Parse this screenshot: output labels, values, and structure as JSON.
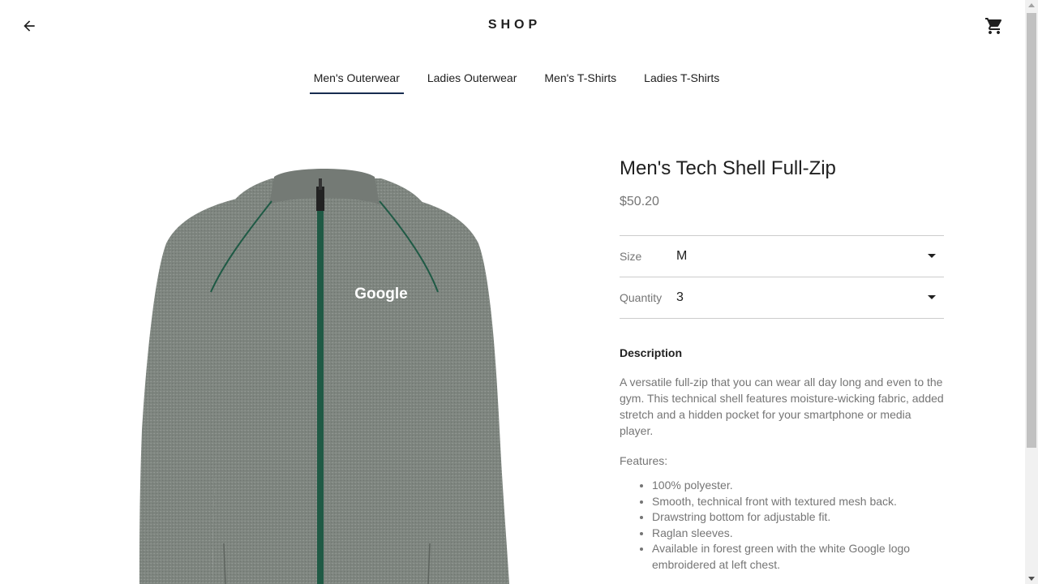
{
  "header": {
    "logo": "SHOP",
    "back_icon": "arrow-back-icon",
    "cart_icon": "shopping-cart-icon"
  },
  "tabs": [
    {
      "label": "Men's Outerwear",
      "active": true
    },
    {
      "label": "Ladies Outerwear",
      "active": false
    },
    {
      "label": "Men's T-Shirts",
      "active": false
    },
    {
      "label": "Ladies T-Shirts",
      "active": false
    }
  ],
  "product": {
    "title": "Men's Tech Shell Full-Zip",
    "price": "$50.20",
    "image_logo_text": "Google",
    "size": {
      "label": "Size",
      "value": "M"
    },
    "quantity": {
      "label": "Quantity",
      "value": "3"
    },
    "description_heading": "Description",
    "description": "A versatile full-zip that you can wear all day long and even to the gym. This technical shell features moisture-wicking fabric, added stretch and a hidden pocket for your smartphone or media player.",
    "features_label": "Features:",
    "features": [
      "100% polyester.",
      "Smooth, technical front with textured mesh back.",
      "Drawstring bottom for adjustable fit.",
      "Raglan sleeves.",
      "Available in forest green with the white Google logo embroidered at left chest."
    ]
  },
  "colors": {
    "accent": "#172c50",
    "text": "#202020",
    "secondary_text": "#757575",
    "divider": "#cccccc",
    "jacket_grey": "#7d837e",
    "zip_green": "#1f5a45"
  }
}
